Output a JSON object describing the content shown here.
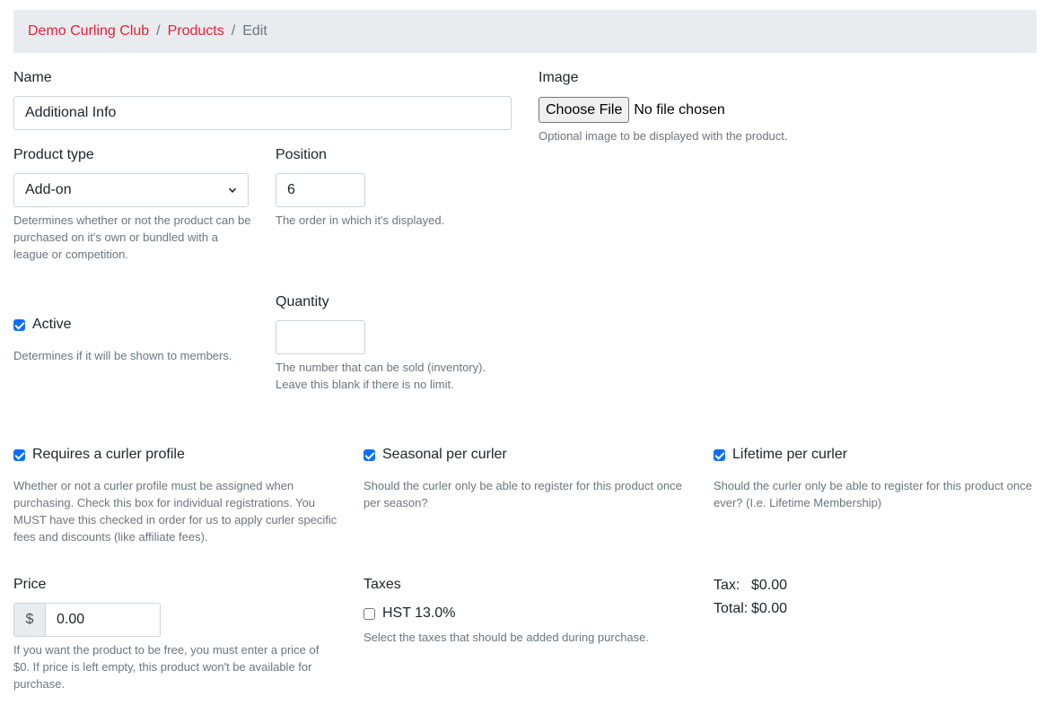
{
  "breadcrumb": {
    "club": "Demo Curling Club",
    "products": "Products",
    "current": "Edit",
    "separator": "/"
  },
  "name": {
    "label": "Name",
    "value": "Additional Info"
  },
  "image": {
    "label": "Image",
    "button": "Choose File",
    "status": "No file chosen",
    "help": "Optional image to be displayed with the product."
  },
  "product_type": {
    "label": "Product type",
    "value": "Add-on",
    "help": "Determines whether or not the product can be purchased on it's own or bundled with a league or competition."
  },
  "position": {
    "label": "Position",
    "value": "6",
    "help": "The order in which it's displayed."
  },
  "active": {
    "label": "Active",
    "checked": true,
    "help": "Determines if it will be shown to members."
  },
  "quantity": {
    "label": "Quantity",
    "value": "",
    "help": "The number that can be sold (inventory). Leave this blank if there is no limit."
  },
  "requires_profile": {
    "label": "Requires a curler profile",
    "checked": true,
    "help": "Whether or not a curler profile must be assigned when purchasing. Check this box for individual registrations. You MUST have this checked in order for us to apply curler specific fees and discounts (like affiliate fees)."
  },
  "seasonal": {
    "label": "Seasonal per curler",
    "checked": true,
    "help": "Should the curler only be able to register for this product once per season?"
  },
  "lifetime": {
    "label": "Lifetime per curler",
    "checked": true,
    "help": "Should the curler only be able to register for this product once ever? (I.e. Lifetime Membership)"
  },
  "price": {
    "label": "Price",
    "currency": "$",
    "value": "0.00",
    "help": "If you want the product to be free, you must enter a price of $0. If price is left empty, this product won't be available for purchase."
  },
  "taxes": {
    "label": "Taxes",
    "option": "HST 13.0%",
    "checked": false,
    "help": "Select the taxes that should be added during purchase."
  },
  "totals": {
    "tax_label": "Tax:",
    "tax_value": "$0.00",
    "total_label": "Total:",
    "total_value": "$0.00"
  },
  "colors": {
    "link": "#e8203a",
    "accent": "#0d6efd",
    "muted": "#6c757d"
  }
}
